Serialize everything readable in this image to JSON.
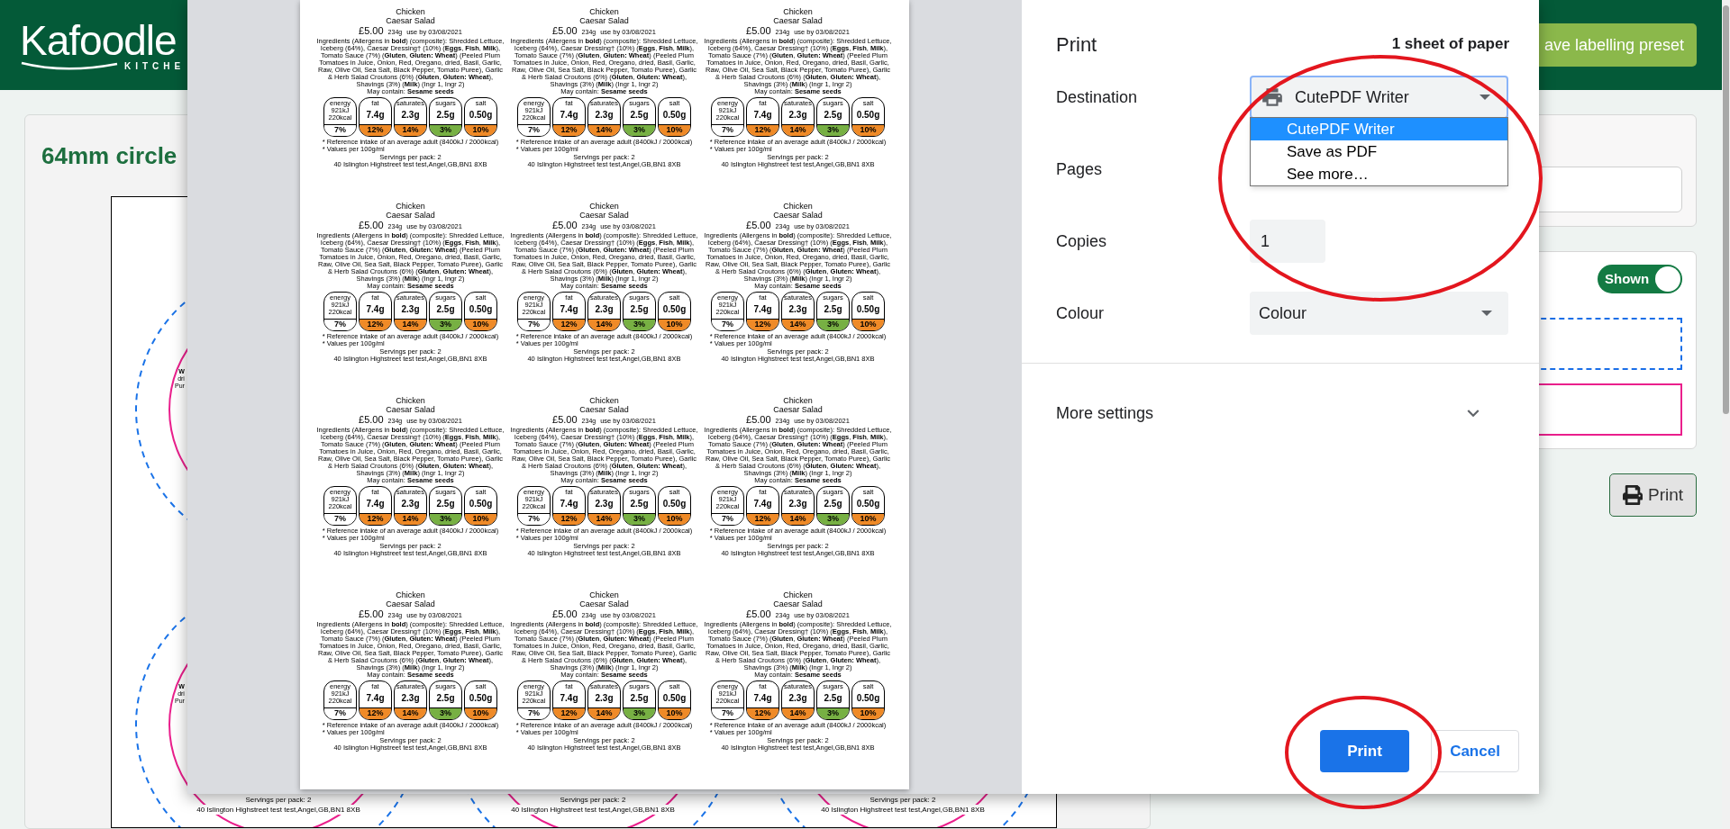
{
  "page": {
    "logo": {
      "name": "Kafoodle",
      "tagline": "KITCHE"
    },
    "save_preset_button": "ave labelling preset",
    "heading": "64mm circle",
    "circle_fragments": [
      {
        "lines": [
          "W",
          "dri",
          "Pur"
        ]
      },
      {
        "lines": [
          "W",
          "dri",
          "Pur"
        ]
      }
    ],
    "circle_footers": [
      {
        "servings": "Servings per pack: 2",
        "address": "40 Islington Highstreet test test,Angel,GB,BN1 8XB"
      },
      {
        "servings": "Servings per pack: 2",
        "address": "40 Islington Highstreet test test,Angel,GB,BN1 8XB"
      },
      {
        "servings": "Servings per pack: 2",
        "address": "40 Islington Highstreet test test,Angel,GB,BN1 8XB"
      }
    ],
    "display_toggle": {
      "label": "Shown",
      "on": true
    },
    "print_button": "Print"
  },
  "print_dialog": {
    "title": "Print",
    "sheet_count": "1 sheet of paper",
    "settings": [
      {
        "kind": "destination",
        "label": "Destination",
        "value": "CutePDF Writer",
        "expanded": true,
        "options": [
          {
            "label": "CutePDF Writer",
            "selected": true
          },
          {
            "label": "Save as PDF",
            "selected": false
          },
          {
            "label": "See more…",
            "selected": false
          }
        ]
      },
      {
        "kind": "pages",
        "label": "Pages"
      },
      {
        "kind": "input",
        "label": "Copies",
        "value": "1"
      },
      {
        "kind": "select",
        "label": "Colour",
        "value": "Colour"
      }
    ],
    "more_settings": {
      "label": "More settings",
      "expanded": false
    },
    "buttons": [
      {
        "kind": "primary",
        "label": "Print"
      },
      {
        "kind": "secondary",
        "label": "Cancel"
      }
    ],
    "preview": {
      "labels": [
        {
          "name_lines": [
            "Chicken",
            "Caesar Salad"
          ],
          "price": "£5.00",
          "weight": "234g",
          "use_by": "use by 03/08/2021",
          "ingredients": "Ingredients (Allergens in **bold**) (composite): Shredded Lettuce, Iceberg (64%), Caesar Dressing† (10%) (**Eggs**, **Fish**, **Milk**), Tomato Sauce (7%) (**Gluten**, **Gluten: Wheat**) (Peeled Plum Tomatoes in Juice, Onion, Red, Oregano, dried, Basil, Garlic, Raw, Olive Oil, Sea Salt, Black Pepper, Tomato Puree), Garlic & Herb Salad Croutons (6%) (**Gluten**, **Gluten: Wheat**), Shavings (3%) (**Milk**) (Ingr 1, Ingr 2)",
          "may_contain": "May contain: **Sesame seeds**",
          "nutrition": [
            {
              "kind": "energy",
              "name": "energy",
              "amounts": [
                "921kJ",
                "220kcal"
              ],
              "percent": "7%",
              "color": "#ffffff"
            },
            {
              "kind": "nutrient",
              "name": "fat",
              "amount": "7.4g",
              "percent": "12%",
              "color": "#ef8a27"
            },
            {
              "kind": "nutrient",
              "name": "saturates",
              "amount": "2.3g",
              "percent": "14%",
              "color": "#ef8a27"
            },
            {
              "kind": "nutrient",
              "name": "sugars",
              "amount": "2.5g",
              "percent": "3%",
              "color": "#77b043"
            },
            {
              "kind": "nutrient",
              "name": "salt",
              "amount": "0.50g",
              "percent": "10%",
              "color": "#ef8a27"
            }
          ],
          "footnotes": [
            "* Reference intake of an average adult (8400kJ / 2000kcal)",
            "* Values per 100g/ml"
          ],
          "servings": "Servings per pack: 2",
          "address": "40 Islington Highstreet test test,Angel,GB,BN1 8XB"
        },
        {
          "name_lines": [
            "Chicken",
            "Caesar Salad"
          ],
          "price": "£5.00",
          "weight": "234g",
          "use_by": "use by 03/08/2021",
          "ingredients": "Ingredients (Allergens in **bold**) (composite): Shredded Lettuce, Iceberg (64%), Caesar Dressing† (10%) (**Eggs**, **Fish**, **Milk**), Tomato Sauce (7%) (**Gluten**, **Gluten: Wheat**) (Peeled Plum Tomatoes in Juice, Onion, Red, Oregano, dried, Basil, Garlic, Raw, Olive Oil, Sea Salt, Black Pepper, Tomato Puree), Garlic & Herb Salad Croutons (6%) (**Gluten**, **Gluten: Wheat**), Shavings (3%) (**Milk**) (Ingr 1, Ingr 2)",
          "may_contain": "May contain: **Sesame seeds**",
          "nutrition": [
            {
              "kind": "energy",
              "name": "energy",
              "amounts": [
                "921kJ",
                "220kcal"
              ],
              "percent": "7%",
              "color": "#ffffff"
            },
            {
              "kind": "nutrient",
              "name": "fat",
              "amount": "7.4g",
              "percent": "12%",
              "color": "#ef8a27"
            },
            {
              "kind": "nutrient",
              "name": "saturates",
              "amount": "2.3g",
              "percent": "14%",
              "color": "#ef8a27"
            },
            {
              "kind": "nutrient",
              "name": "sugars",
              "amount": "2.5g",
              "percent": "3%",
              "color": "#77b043"
            },
            {
              "kind": "nutrient",
              "name": "salt",
              "amount": "0.50g",
              "percent": "10%",
              "color": "#ef8a27"
            }
          ],
          "footnotes": [
            "* Reference intake of an average adult (8400kJ / 2000kcal)",
            "* Values per 100g/ml"
          ],
          "servings": "Servings per pack: 2",
          "address": "40 Islington Highstreet test test,Angel,GB,BN1 8XB"
        },
        {
          "name_lines": [
            "Chicken",
            "Caesar Salad"
          ],
          "price": "£5.00",
          "weight": "234g",
          "use_by": "use by 03/08/2021",
          "ingredients": "Ingredients (Allergens in **bold**) (composite): Shredded Lettuce, Iceberg (64%), Caesar Dressing† (10%) (**Eggs**, **Fish**, **Milk**), Tomato Sauce (7%) (**Gluten**, **Gluten: Wheat**) (Peeled Plum Tomatoes in Juice, Onion, Red, Oregano, dried, Basil, Garlic, Raw, Olive Oil, Sea Salt, Black Pepper, Tomato Puree), Garlic & Herb Salad Croutons (6%) (**Gluten**, **Gluten: Wheat**), Shavings (3%) (**Milk**) (Ingr 1, Ingr 2)",
          "may_contain": "May contain: **Sesame seeds**",
          "nutrition": [
            {
              "kind": "energy",
              "name": "energy",
              "amounts": [
                "921kJ",
                "220kcal"
              ],
              "percent": "7%",
              "color": "#ffffff"
            },
            {
              "kind": "nutrient",
              "name": "fat",
              "amount": "7.4g",
              "percent": "12%",
              "color": "#ef8a27"
            },
            {
              "kind": "nutrient",
              "name": "saturates",
              "amount": "2.3g",
              "percent": "14%",
              "color": "#ef8a27"
            },
            {
              "kind": "nutrient",
              "name": "sugars",
              "amount": "2.5g",
              "percent": "3%",
              "color": "#77b043"
            },
            {
              "kind": "nutrient",
              "name": "salt",
              "amount": "0.50g",
              "percent": "10%",
              "color": "#ef8a27"
            }
          ],
          "footnotes": [
            "* Reference intake of an average adult (8400kJ / 2000kcal)",
            "* Values per 100g/ml"
          ],
          "servings": "Servings per pack: 2",
          "address": "40 Islington Highstreet test test,Angel,GB,BN1 8XB"
        },
        {
          "name_lines": [
            "Chicken",
            "Caesar Salad"
          ],
          "price": "£5.00",
          "weight": "234g",
          "use_by": "use by 03/08/2021",
          "ingredients": "Ingredients (Allergens in **bold**) (composite): Shredded Lettuce, Iceberg (64%), Caesar Dressing† (10%) (**Eggs**, **Fish**, **Milk**), Tomato Sauce (7%) (**Gluten**, **Gluten: Wheat**) (Peeled Plum Tomatoes in Juice, Onion, Red, Oregano, dried, Basil, Garlic, Raw, Olive Oil, Sea Salt, Black Pepper, Tomato Puree), Garlic & Herb Salad Croutons (6%) (**Gluten**, **Gluten: Wheat**), Shavings (3%) (**Milk**) (Ingr 1, Ingr 2)",
          "may_contain": "May contain: **Sesame seeds**",
          "nutrition": [
            {
              "kind": "energy",
              "name": "energy",
              "amounts": [
                "921kJ",
                "220kcal"
              ],
              "percent": "7%",
              "color": "#ffffff"
            },
            {
              "kind": "nutrient",
              "name": "fat",
              "amount": "7.4g",
              "percent": "12%",
              "color": "#ef8a27"
            },
            {
              "kind": "nutrient",
              "name": "saturates",
              "amount": "2.3g",
              "percent": "14%",
              "color": "#ef8a27"
            },
            {
              "kind": "nutrient",
              "name": "sugars",
              "amount": "2.5g",
              "percent": "3%",
              "color": "#77b043"
            },
            {
              "kind": "nutrient",
              "name": "salt",
              "amount": "0.50g",
              "percent": "10%",
              "color": "#ef8a27"
            }
          ],
          "footnotes": [
            "* Reference intake of an average adult (8400kJ / 2000kcal)",
            "* Values per 100g/ml"
          ],
          "servings": "Servings per pack: 2",
          "address": "40 Islington Highstreet test test,Angel,GB,BN1 8XB"
        },
        {
          "name_lines": [
            "Chicken",
            "Caesar Salad"
          ],
          "price": "£5.00",
          "weight": "234g",
          "use_by": "use by 03/08/2021",
          "ingredients": "Ingredients (Allergens in **bold**) (composite): Shredded Lettuce, Iceberg (64%), Caesar Dressing† (10%) (**Eggs**, **Fish**, **Milk**), Tomato Sauce (7%) (**Gluten**, **Gluten: Wheat**) (Peeled Plum Tomatoes in Juice, Onion, Red, Oregano, dried, Basil, Garlic, Raw, Olive Oil, Sea Salt, Black Pepper, Tomato Puree), Garlic & Herb Salad Croutons (6%) (**Gluten**, **Gluten: Wheat**), Shavings (3%) (**Milk**) (Ingr 1, Ingr 2)",
          "may_contain": "May contain: **Sesame seeds**",
          "nutrition": [
            {
              "kind": "energy",
              "name": "energy",
              "amounts": [
                "921kJ",
                "220kcal"
              ],
              "percent": "7%",
              "color": "#ffffff"
            },
            {
              "kind": "nutrient",
              "name": "fat",
              "amount": "7.4g",
              "percent": "12%",
              "color": "#ef8a27"
            },
            {
              "kind": "nutrient",
              "name": "saturates",
              "amount": "2.3g",
              "percent": "14%",
              "color": "#ef8a27"
            },
            {
              "kind": "nutrient",
              "name": "sugars",
              "amount": "2.5g",
              "percent": "3%",
              "color": "#77b043"
            },
            {
              "kind": "nutrient",
              "name": "salt",
              "amount": "0.50g",
              "percent": "10%",
              "color": "#ef8a27"
            }
          ],
          "footnotes": [
            "* Reference intake of an average adult (8400kJ / 2000kcal)",
            "* Values per 100g/ml"
          ],
          "servings": "Servings per pack: 2",
          "address": "40 Islington Highstreet test test,Angel,GB,BN1 8XB"
        },
        {
          "name_lines": [
            "Chicken",
            "Caesar Salad"
          ],
          "price": "£5.00",
          "weight": "234g",
          "use_by": "use by 03/08/2021",
          "ingredients": "Ingredients (Allergens in **bold**) (composite): Shredded Lettuce, Iceberg (64%), Caesar Dressing† (10%) (**Eggs**, **Fish**, **Milk**), Tomato Sauce (7%) (**Gluten**, **Gluten: Wheat**) (Peeled Plum Tomatoes in Juice, Onion, Red, Oregano, dried, Basil, Garlic, Raw, Olive Oil, Sea Salt, Black Pepper, Tomato Puree), Garlic & Herb Salad Croutons (6%) (**Gluten**, **Gluten: Wheat**), Shavings (3%) (**Milk**) (Ingr 1, Ingr 2)",
          "may_contain": "May contain: **Sesame seeds**",
          "nutrition": [
            {
              "kind": "energy",
              "name": "energy",
              "amounts": [
                "921kJ",
                "220kcal"
              ],
              "percent": "7%",
              "color": "#ffffff"
            },
            {
              "kind": "nutrient",
              "name": "fat",
              "amount": "7.4g",
              "percent": "12%",
              "color": "#ef8a27"
            },
            {
              "kind": "nutrient",
              "name": "saturates",
              "amount": "2.3g",
              "percent": "14%",
              "color": "#ef8a27"
            },
            {
              "kind": "nutrient",
              "name": "sugars",
              "amount": "2.5g",
              "percent": "3%",
              "color": "#77b043"
            },
            {
              "kind": "nutrient",
              "name": "salt",
              "amount": "0.50g",
              "percent": "10%",
              "color": "#ef8a27"
            }
          ],
          "footnotes": [
            "* Reference intake of an average adult (8400kJ / 2000kcal)",
            "* Values per 100g/ml"
          ],
          "servings": "Servings per pack: 2",
          "address": "40 Islington Highstreet test test,Angel,GB,BN1 8XB"
        },
        {
          "name_lines": [
            "Chicken",
            "Caesar Salad"
          ],
          "price": "£5.00",
          "weight": "234g",
          "use_by": "use by 03/08/2021",
          "ingredients": "Ingredients (Allergens in **bold**) (composite): Shredded Lettuce, Iceberg (64%), Caesar Dressing† (10%) (**Eggs**, **Fish**, **Milk**), Tomato Sauce (7%) (**Gluten**, **Gluten: Wheat**) (Peeled Plum Tomatoes in Juice, Onion, Red, Oregano, dried, Basil, Garlic, Raw, Olive Oil, Sea Salt, Black Pepper, Tomato Puree), Garlic & Herb Salad Croutons (6%) (**Gluten**, **Gluten: Wheat**), Shavings (3%) (**Milk**) (Ingr 1, Ingr 2)",
          "may_contain": "May contain: **Sesame seeds**",
          "nutrition": [
            {
              "kind": "energy",
              "name": "energy",
              "amounts": [
                "921kJ",
                "220kcal"
              ],
              "percent": "7%",
              "color": "#ffffff"
            },
            {
              "kind": "nutrient",
              "name": "fat",
              "amount": "7.4g",
              "percent": "12%",
              "color": "#ef8a27"
            },
            {
              "kind": "nutrient",
              "name": "saturates",
              "amount": "2.3g",
              "percent": "14%",
              "color": "#ef8a27"
            },
            {
              "kind": "nutrient",
              "name": "sugars",
              "amount": "2.5g",
              "percent": "3%",
              "color": "#77b043"
            },
            {
              "kind": "nutrient",
              "name": "salt",
              "amount": "0.50g",
              "percent": "10%",
              "color": "#ef8a27"
            }
          ],
          "footnotes": [
            "* Reference intake of an average adult (8400kJ / 2000kcal)",
            "* Values per 100g/ml"
          ],
          "servings": "Servings per pack: 2",
          "address": "40 Islington Highstreet test test,Angel,GB,BN1 8XB"
        },
        {
          "name_lines": [
            "Chicken",
            "Caesar Salad"
          ],
          "price": "£5.00",
          "weight": "234g",
          "use_by": "use by 03/08/2021",
          "ingredients": "Ingredients (Allergens in **bold**) (composite): Shredded Lettuce, Iceberg (64%), Caesar Dressing† (10%) (**Eggs**, **Fish**, **Milk**), Tomato Sauce (7%) (**Gluten**, **Gluten: Wheat**) (Peeled Plum Tomatoes in Juice, Onion, Red, Oregano, dried, Basil, Garlic, Raw, Olive Oil, Sea Salt, Black Pepper, Tomato Puree), Garlic & Herb Salad Croutons (6%) (**Gluten**, **Gluten: Wheat**), Shavings (3%) (**Milk**) (Ingr 1, Ingr 2)",
          "may_contain": "May contain: **Sesame seeds**",
          "nutrition": [
            {
              "kind": "energy",
              "name": "energy",
              "amounts": [
                "921kJ",
                "220kcal"
              ],
              "percent": "7%",
              "color": "#ffffff"
            },
            {
              "kind": "nutrient",
              "name": "fat",
              "amount": "7.4g",
              "percent": "12%",
              "color": "#ef8a27"
            },
            {
              "kind": "nutrient",
              "name": "saturates",
              "amount": "2.3g",
              "percent": "14%",
              "color": "#ef8a27"
            },
            {
              "kind": "nutrient",
              "name": "sugars",
              "amount": "2.5g",
              "percent": "3%",
              "color": "#77b043"
            },
            {
              "kind": "nutrient",
              "name": "salt",
              "amount": "0.50g",
              "percent": "10%",
              "color": "#ef8a27"
            }
          ],
          "footnotes": [
            "* Reference intake of an average adult (8400kJ / 2000kcal)",
            "* Values per 100g/ml"
          ],
          "servings": "Servings per pack: 2",
          "address": "40 Islington Highstreet test test,Angel,GB,BN1 8XB"
        },
        {
          "name_lines": [
            "Chicken",
            "Caesar Salad"
          ],
          "price": "£5.00",
          "weight": "234g",
          "use_by": "use by 03/08/2021",
          "ingredients": "Ingredients (Allergens in **bold**) (composite): Shredded Lettuce, Iceberg (64%), Caesar Dressing† (10%) (**Eggs**, **Fish**, **Milk**), Tomato Sauce (7%) (**Gluten**, **Gluten: Wheat**) (Peeled Plum Tomatoes in Juice, Onion, Red, Oregano, dried, Basil, Garlic, Raw, Olive Oil, Sea Salt, Black Pepper, Tomato Puree), Garlic & Herb Salad Croutons (6%) (**Gluten**, **Gluten: Wheat**), Shavings (3%) (**Milk**) (Ingr 1, Ingr 2)",
          "may_contain": "May contain: **Sesame seeds**",
          "nutrition": [
            {
              "kind": "energy",
              "name": "energy",
              "amounts": [
                "921kJ",
                "220kcal"
              ],
              "percent": "7%",
              "color": "#ffffff"
            },
            {
              "kind": "nutrient",
              "name": "fat",
              "amount": "7.4g",
              "percent": "12%",
              "color": "#ef8a27"
            },
            {
              "kind": "nutrient",
              "name": "saturates",
              "amount": "2.3g",
              "percent": "14%",
              "color": "#ef8a27"
            },
            {
              "kind": "nutrient",
              "name": "sugars",
              "amount": "2.5g",
              "percent": "3%",
              "color": "#77b043"
            },
            {
              "kind": "nutrient",
              "name": "salt",
              "amount": "0.50g",
              "percent": "10%",
              "color": "#ef8a27"
            }
          ],
          "footnotes": [
            "* Reference intake of an average adult (8400kJ / 2000kcal)",
            "* Values per 100g/ml"
          ],
          "servings": "Servings per pack: 2",
          "address": "40 Islington Highstreet test test,Angel,GB,BN1 8XB"
        },
        {
          "name_lines": [
            "Chicken",
            "Caesar Salad"
          ],
          "price": "£5.00",
          "weight": "234g",
          "use_by": "use by 03/08/2021",
          "ingredients": "Ingredients (Allergens in **bold**) (composite): Shredded Lettuce, Iceberg (64%), Caesar Dressing† (10%) (**Eggs**, **Fish**, **Milk**), Tomato Sauce (7%) (**Gluten**, **Gluten: Wheat**) (Peeled Plum Tomatoes in Juice, Onion, Red, Oregano, dried, Basil, Garlic, Raw, Olive Oil, Sea Salt, Black Pepper, Tomato Puree), Garlic & Herb Salad Croutons (6%) (**Gluten**, **Gluten: Wheat**), Shavings (3%) (**Milk**) (Ingr 1, Ingr 2)",
          "may_contain": "May contain: **Sesame seeds**",
          "nutrition": [
            {
              "kind": "energy",
              "name": "energy",
              "amounts": [
                "921kJ",
                "220kcal"
              ],
              "percent": "7%",
              "color": "#ffffff"
            },
            {
              "kind": "nutrient",
              "name": "fat",
              "amount": "7.4g",
              "percent": "12%",
              "color": "#ef8a27"
            },
            {
              "kind": "nutrient",
              "name": "saturates",
              "amount": "2.3g",
              "percent": "14%",
              "color": "#ef8a27"
            },
            {
              "kind": "nutrient",
              "name": "sugars",
              "amount": "2.5g",
              "percent": "3%",
              "color": "#77b043"
            },
            {
              "kind": "nutrient",
              "name": "salt",
              "amount": "0.50g",
              "percent": "10%",
              "color": "#ef8a27"
            }
          ],
          "footnotes": [
            "* Reference intake of an average adult (8400kJ / 2000kcal)",
            "* Values per 100g/ml"
          ],
          "servings": "Servings per pack: 2",
          "address": "40 Islington Highstreet test test,Angel,GB,BN1 8XB"
        },
        {
          "name_lines": [
            "Chicken",
            "Caesar Salad"
          ],
          "price": "£5.00",
          "weight": "234g",
          "use_by": "use by 03/08/2021",
          "ingredients": "Ingredients (Allergens in **bold**) (composite): Shredded Lettuce, Iceberg (64%), Caesar Dressing† (10%) (**Eggs**, **Fish**, **Milk**), Tomato Sauce (7%) (**Gluten**, **Gluten: Wheat**) (Peeled Plum Tomatoes in Juice, Onion, Red, Oregano, dried, Basil, Garlic, Raw, Olive Oil, Sea Salt, Black Pepper, Tomato Puree), Garlic & Herb Salad Croutons (6%) (**Gluten**, **Gluten: Wheat**), Shavings (3%) (**Milk**) (Ingr 1, Ingr 2)",
          "may_contain": "May contain: **Sesame seeds**",
          "nutrition": [
            {
              "kind": "energy",
              "name": "energy",
              "amounts": [
                "921kJ",
                "220kcal"
              ],
              "percent": "7%",
              "color": "#ffffff"
            },
            {
              "kind": "nutrient",
              "name": "fat",
              "amount": "7.4g",
              "percent": "12%",
              "color": "#ef8a27"
            },
            {
              "kind": "nutrient",
              "name": "saturates",
              "amount": "2.3g",
              "percent": "14%",
              "color": "#ef8a27"
            },
            {
              "kind": "nutrient",
              "name": "sugars",
              "amount": "2.5g",
              "percent": "3%",
              "color": "#77b043"
            },
            {
              "kind": "nutrient",
              "name": "salt",
              "amount": "0.50g",
              "percent": "10%",
              "color": "#ef8a27"
            }
          ],
          "footnotes": [
            "* Reference intake of an average adult (8400kJ / 2000kcal)",
            "* Values per 100g/ml"
          ],
          "servings": "Servings per pack: 2",
          "address": "40 Islington Highstreet test test,Angel,GB,BN1 8XB"
        },
        {
          "name_lines": [
            "Chicken",
            "Caesar Salad"
          ],
          "price": "£5.00",
          "weight": "234g",
          "use_by": "use by 03/08/2021",
          "ingredients": "Ingredients (Allergens in **bold**) (composite): Shredded Lettuce, Iceberg (64%), Caesar Dressing† (10%) (**Eggs**, **Fish**, **Milk**), Tomato Sauce (7%) (**Gluten**, **Gluten: Wheat**) (Peeled Plum Tomatoes in Juice, Onion, Red, Oregano, dried, Basil, Garlic, Raw, Olive Oil, Sea Salt, Black Pepper, Tomato Puree), Garlic & Herb Salad Croutons (6%) (**Gluten**, **Gluten: Wheat**), Shavings (3%) (**Milk**) (Ingr 1, Ingr 2)",
          "may_contain": "May contain: **Sesame seeds**",
          "nutrition": [
            {
              "kind": "energy",
              "name": "energy",
              "amounts": [
                "921kJ",
                "220kcal"
              ],
              "percent": "7%",
              "color": "#ffffff"
            },
            {
              "kind": "nutrient",
              "name": "fat",
              "amount": "7.4g",
              "percent": "12%",
              "color": "#ef8a27"
            },
            {
              "kind": "nutrient",
              "name": "saturates",
              "amount": "2.3g",
              "percent": "14%",
              "color": "#ef8a27"
            },
            {
              "kind": "nutrient",
              "name": "sugars",
              "amount": "2.5g",
              "percent": "3%",
              "color": "#77b043"
            },
            {
              "kind": "nutrient",
              "name": "salt",
              "amount": "0.50g",
              "percent": "10%",
              "color": "#ef8a27"
            }
          ],
          "footnotes": [
            "* Reference intake of an average adult (8400kJ / 2000kcal)",
            "* Values per 100g/ml"
          ],
          "servings": "Servings per pack: 2",
          "address": "40 Islington Highstreet test test,Angel,GB,BN1 8XB"
        }
      ]
    }
  }
}
